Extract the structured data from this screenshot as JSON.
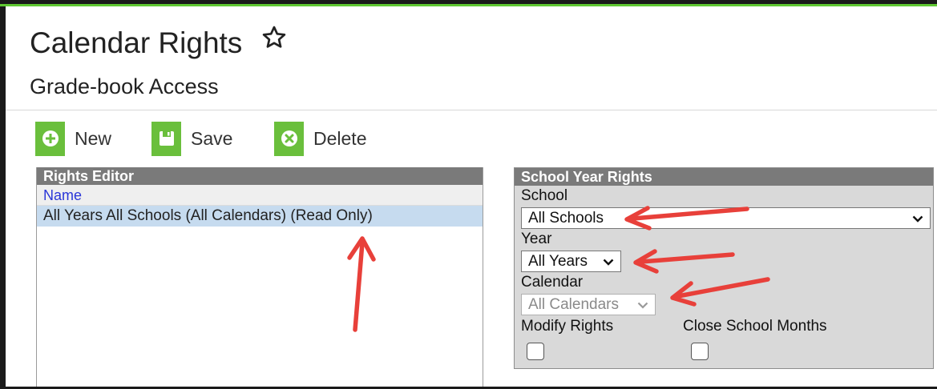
{
  "page": {
    "title": "Calendar Rights",
    "subtitle": "Grade-book Access"
  },
  "toolbar": {
    "new_label": "New",
    "save_label": "Save",
    "delete_label": "Delete",
    "button_color": "#6abf3c"
  },
  "rights_editor": {
    "header": "Rights Editor",
    "column_name": "Name",
    "rows": [
      "All Years All Schools (All Calendars) (Read Only)"
    ],
    "selected_row_color": "#c6dbef"
  },
  "school_year_rights": {
    "header": "School Year Rights",
    "school_label": "School",
    "school_value": "All Schools",
    "year_label": "Year",
    "year_value": "All Years",
    "calendar_label": "Calendar",
    "calendar_value": "All Calendars",
    "modify_rights_label": "Modify Rights",
    "modify_rights_checked": false,
    "close_school_months_label": "Close School Months",
    "close_school_months_checked": false
  },
  "annotations": {
    "arrow_color": "#e8403a",
    "arrows": [
      "up-arrow",
      "left-arrow",
      "left-arrow",
      "left-arrow"
    ]
  }
}
